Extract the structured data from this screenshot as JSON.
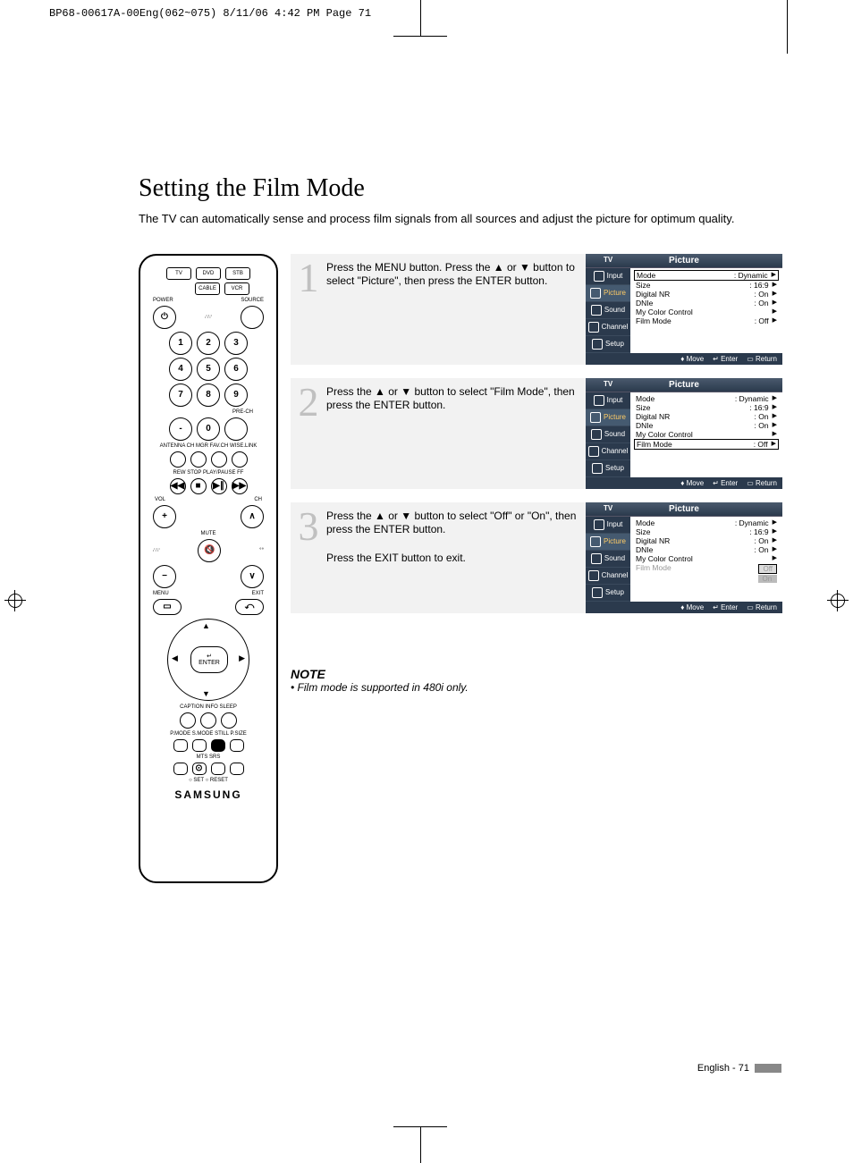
{
  "header_line": "BP68-00617A-00Eng(062~075)  8/11/06  4:42 PM  Page 71",
  "title": "Setting the Film Mode",
  "intro": "The TV can automatically sense and process film signals from all sources and adjust the picture for optimum quality.",
  "remote": {
    "source_row": [
      "TV",
      "DVD",
      "STB"
    ],
    "source_row2": [
      "CABLE",
      "VCR"
    ],
    "power": "POWER",
    "source": "SOURCE",
    "numpad": [
      "1",
      "2",
      "3",
      "4",
      "5",
      "6",
      "7",
      "8",
      "9",
      "-",
      "0"
    ],
    "prech": "PRE-CH",
    "labels_row": "ANTENNA  CH MGR  FAV.CH  WISE.LINK",
    "transport": "REW  STOP  PLAY/PAUSE  FF",
    "vol": "VOL",
    "ch": "CH",
    "mute": "MUTE",
    "menu": "MENU",
    "exit": "EXIT",
    "enter": "ENTER",
    "labels_bottom1": "CAPTION   INFO   SLEEP",
    "labels_bottom2": "P.MODE  S.MODE  STILL  P.SIZE",
    "labels_bottom3": "MTS   SRS",
    "setreset": "○ SET    ○ RESET",
    "brand": "SAMSUNG"
  },
  "steps": [
    {
      "num": "1",
      "text": "Press the MENU button. Press the ▲ or ▼ button to select \"Picture\", then press the ENTER button.",
      "osd": {
        "title": "Picture",
        "highlight": 0,
        "items": [
          {
            "label": "Mode",
            "value": ": Dynamic"
          },
          {
            "label": "Size",
            "value": ": 16:9"
          },
          {
            "label": "Digital NR",
            "value": ": On"
          },
          {
            "label": "DNIe",
            "value": ": On"
          },
          {
            "label": "My Color Control",
            "value": ""
          },
          {
            "label": "Film Mode",
            "value": ": Off"
          }
        ]
      }
    },
    {
      "num": "2",
      "text": "Press the ▲ or ▼ button to select \"Film Mode\", then press the ENTER button.",
      "osd": {
        "title": "Picture",
        "highlight": 5,
        "items": [
          {
            "label": "Mode",
            "value": ": Dynamic"
          },
          {
            "label": "Size",
            "value": ": 16:9"
          },
          {
            "label": "Digital NR",
            "value": ": On"
          },
          {
            "label": "DNIe",
            "value": ": On"
          },
          {
            "label": "My Color Control",
            "value": ""
          },
          {
            "label": "Film Mode",
            "value": ": Off"
          }
        ]
      }
    },
    {
      "num": "3",
      "text": "Press the ▲ or ▼ button to select \"Off\" or \"On\", then press the ENTER button.\n\nPress the EXIT button to exit.",
      "osd": {
        "title": "Picture",
        "highlight": -1,
        "items": [
          {
            "label": "Mode",
            "value": ": Dynamic"
          },
          {
            "label": "Size",
            "value": ": 16:9"
          },
          {
            "label": "Digital NR",
            "value": ": On"
          },
          {
            "label": "DNIe",
            "value": ": On"
          },
          {
            "label": "My Color Control",
            "value": ""
          },
          {
            "label": "Film Mode",
            "value": ""
          }
        ],
        "options": [
          "Off",
          "On"
        ],
        "opt_sel": 0
      }
    }
  ],
  "sidebar_items": [
    "Input",
    "Picture",
    "Sound",
    "Channel",
    "Setup"
  ],
  "osd_footer": {
    "move": "Move",
    "enter": "Enter",
    "return": "Return"
  },
  "osd_tv": "TV",
  "note_title": "NOTE",
  "note_text": "Film mode is supported in 480i only.",
  "page_number": "English - 71"
}
